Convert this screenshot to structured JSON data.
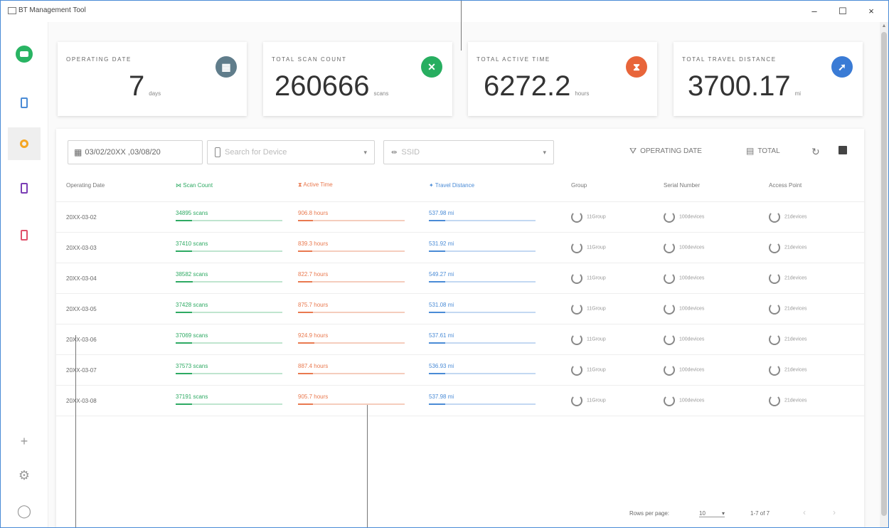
{
  "window": {
    "title": "BT Management Tool",
    "controls": {
      "minimize": "–",
      "maximize": "☐",
      "close": "×"
    }
  },
  "sidebar": {
    "bottom_icons": {
      "add": "+",
      "settings": "⚙",
      "info": "◯"
    }
  },
  "summary_cards": [
    {
      "label": "OPERATING DATE",
      "value": "7",
      "unit": "days",
      "icon": "calendar-icon",
      "color": "#607d8b"
    },
    {
      "label": "TOTAL SCAN COUNT",
      "value": "260666",
      "unit": "scans",
      "icon": "scan-icon",
      "color": "#27ae60"
    },
    {
      "label": "TOTAL ACTIVE TIME",
      "value": "6272.2",
      "unit": "hours",
      "icon": "timer-icon",
      "color": "#e8653a"
    },
    {
      "label": "TOTAL TRAVEL DISTANCE",
      "value": "3700.17",
      "unit": "mi",
      "icon": "walk-icon",
      "color": "#3a7bd5"
    }
  ],
  "filters": {
    "date_range": "03/02/20XX ,03/08/20",
    "device_search_placeholder": "Search for Device",
    "ssid_placeholder": "SSID",
    "dropdown_caret": "▾"
  },
  "toolbar": {
    "operating_date_label": "OPERATING DATE",
    "total_label": "TOTAL",
    "refresh_icon": "↻",
    "save_icon": "save-icon"
  },
  "table": {
    "headers": {
      "date": "Operating Date",
      "scan": "Scan Count",
      "active": "Active Time",
      "travel": "Travel Distance",
      "group": "Group",
      "serial": "Serial Number",
      "ap": "Access Point"
    },
    "rows": [
      {
        "date": "20XX-03-02",
        "scan": "34895 scans",
        "scan_pct": 0.15,
        "active": "906.8 hours",
        "active_pct": 0.14,
        "travel": "537.98 mi",
        "travel_pct": 0.15,
        "group": "11Group",
        "serial": "100devices",
        "ap": "21devices"
      },
      {
        "date": "20XX-03-03",
        "scan": "37410 scans",
        "scan_pct": 0.15,
        "active": "839.3 hours",
        "active_pct": 0.13,
        "travel": "531.92 mi",
        "travel_pct": 0.15,
        "group": "11Group",
        "serial": "100devices",
        "ap": "21devices"
      },
      {
        "date": "20XX-03-04",
        "scan": "38582 scans",
        "scan_pct": 0.16,
        "active": "822.7 hours",
        "active_pct": 0.13,
        "travel": "549.27 mi",
        "travel_pct": 0.15,
        "group": "11Group",
        "serial": "100devices",
        "ap": "21devices"
      },
      {
        "date": "20XX-03-05",
        "scan": "37428 scans",
        "scan_pct": 0.15,
        "active": "875.7 hours",
        "active_pct": 0.14,
        "travel": "531.08 mi",
        "travel_pct": 0.15,
        "group": "11Group",
        "serial": "100devices",
        "ap": "21devices"
      },
      {
        "date": "20XX-03-06",
        "scan": "37069 scans",
        "scan_pct": 0.15,
        "active": "924.9 hours",
        "active_pct": 0.15,
        "travel": "537.61 mi",
        "travel_pct": 0.15,
        "group": "11Group",
        "serial": "100devices",
        "ap": "21devices"
      },
      {
        "date": "20XX-03-07",
        "scan": "37573 scans",
        "scan_pct": 0.15,
        "active": "887.4 hours",
        "active_pct": 0.14,
        "travel": "536.93 mi",
        "travel_pct": 0.15,
        "group": "11Group",
        "serial": "100devices",
        "ap": "21devices"
      },
      {
        "date": "20XX-03-08",
        "scan": "37191 scans",
        "scan_pct": 0.15,
        "active": "905.7 hours",
        "active_pct": 0.14,
        "travel": "537.98 mi",
        "travel_pct": 0.15,
        "group": "11Group",
        "serial": "100devices",
        "ap": "21devices"
      }
    ]
  },
  "pagination": {
    "rows_per_page_label": "Rows per page:",
    "rows_per_page_value": "10",
    "range": "1-7 of 7",
    "prev": "‹",
    "next": "›"
  }
}
